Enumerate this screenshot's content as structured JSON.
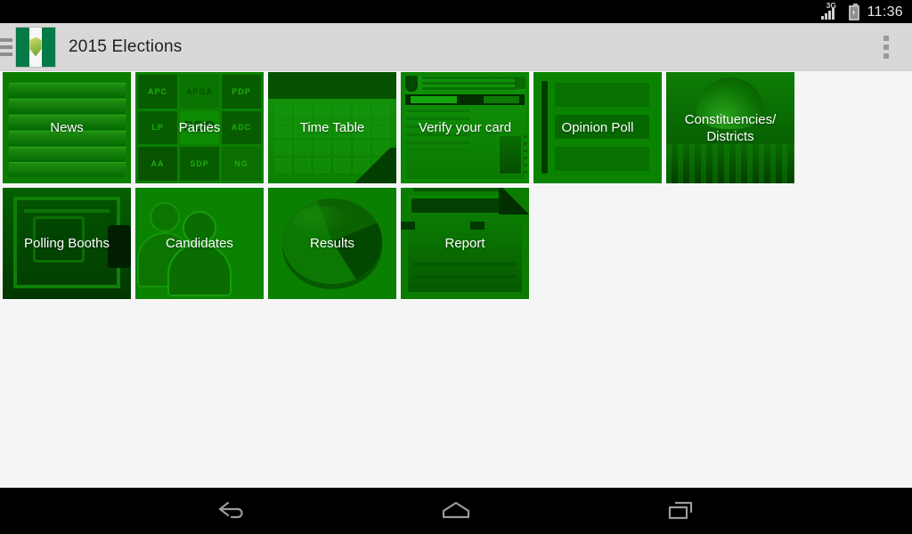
{
  "statusbar": {
    "network_label": "3G",
    "signal_icon": "signal-bars-icon",
    "battery_icon": "battery-charging-icon",
    "clock": "11:36"
  },
  "actionbar": {
    "menu_icon": "hamburger-menu-icon",
    "logo_icon": "nigeria-flag-logo-icon",
    "title": "2015 Elections",
    "overflow_icon": "overflow-menu-icon"
  },
  "grid": {
    "tiles": [
      {
        "label": "News",
        "art": "newspaper-stack"
      },
      {
        "label": "Parties",
        "art": "party-logos-grid"
      },
      {
        "label": "Time Table",
        "art": "calendar"
      },
      {
        "label": "Verify your card",
        "art": "voter-card"
      },
      {
        "label": "Opinion Poll",
        "art": "survey-form"
      },
      {
        "label": "Constituencies/\nDistricts",
        "art": "dome-building"
      },
      {
        "label": "Polling Booths",
        "art": "polling-booth"
      },
      {
        "label": "Candidates",
        "art": "people-group"
      },
      {
        "label": "Results",
        "art": "pie-chart"
      },
      {
        "label": "Report",
        "art": "document"
      }
    ],
    "party_logos": [
      "APC",
      "APGA",
      "PDP",
      "LP",
      "PDP",
      "ADC",
      "AA",
      "SDP",
      "NG"
    ]
  },
  "navbar": {
    "back_icon": "back-arrow-icon",
    "home_icon": "home-icon",
    "recents_icon": "recent-apps-icon"
  },
  "colors": {
    "tile_green": "#0a8000",
    "brand_green": "#047a46",
    "actionbar": "#d8d8d8",
    "background": "#f5f5f5"
  }
}
